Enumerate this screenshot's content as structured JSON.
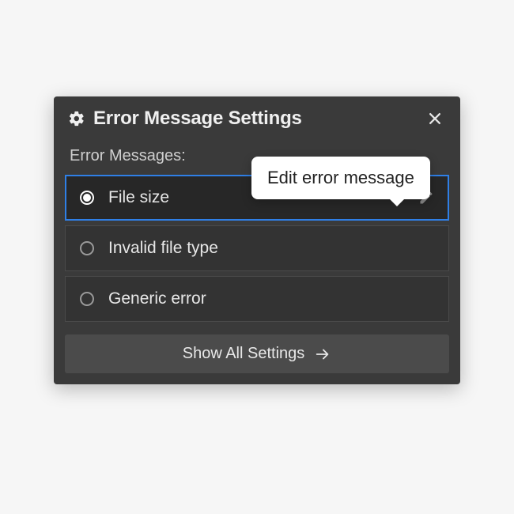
{
  "header": {
    "title": "Error Message Settings"
  },
  "section_label": "Error Messages:",
  "tooltip": "Edit error message",
  "rows": [
    {
      "label": "File size",
      "selected": true
    },
    {
      "label": "Invalid file type",
      "selected": false
    },
    {
      "label": "Generic error",
      "selected": false
    }
  ],
  "footer_button": "Show All Settings"
}
